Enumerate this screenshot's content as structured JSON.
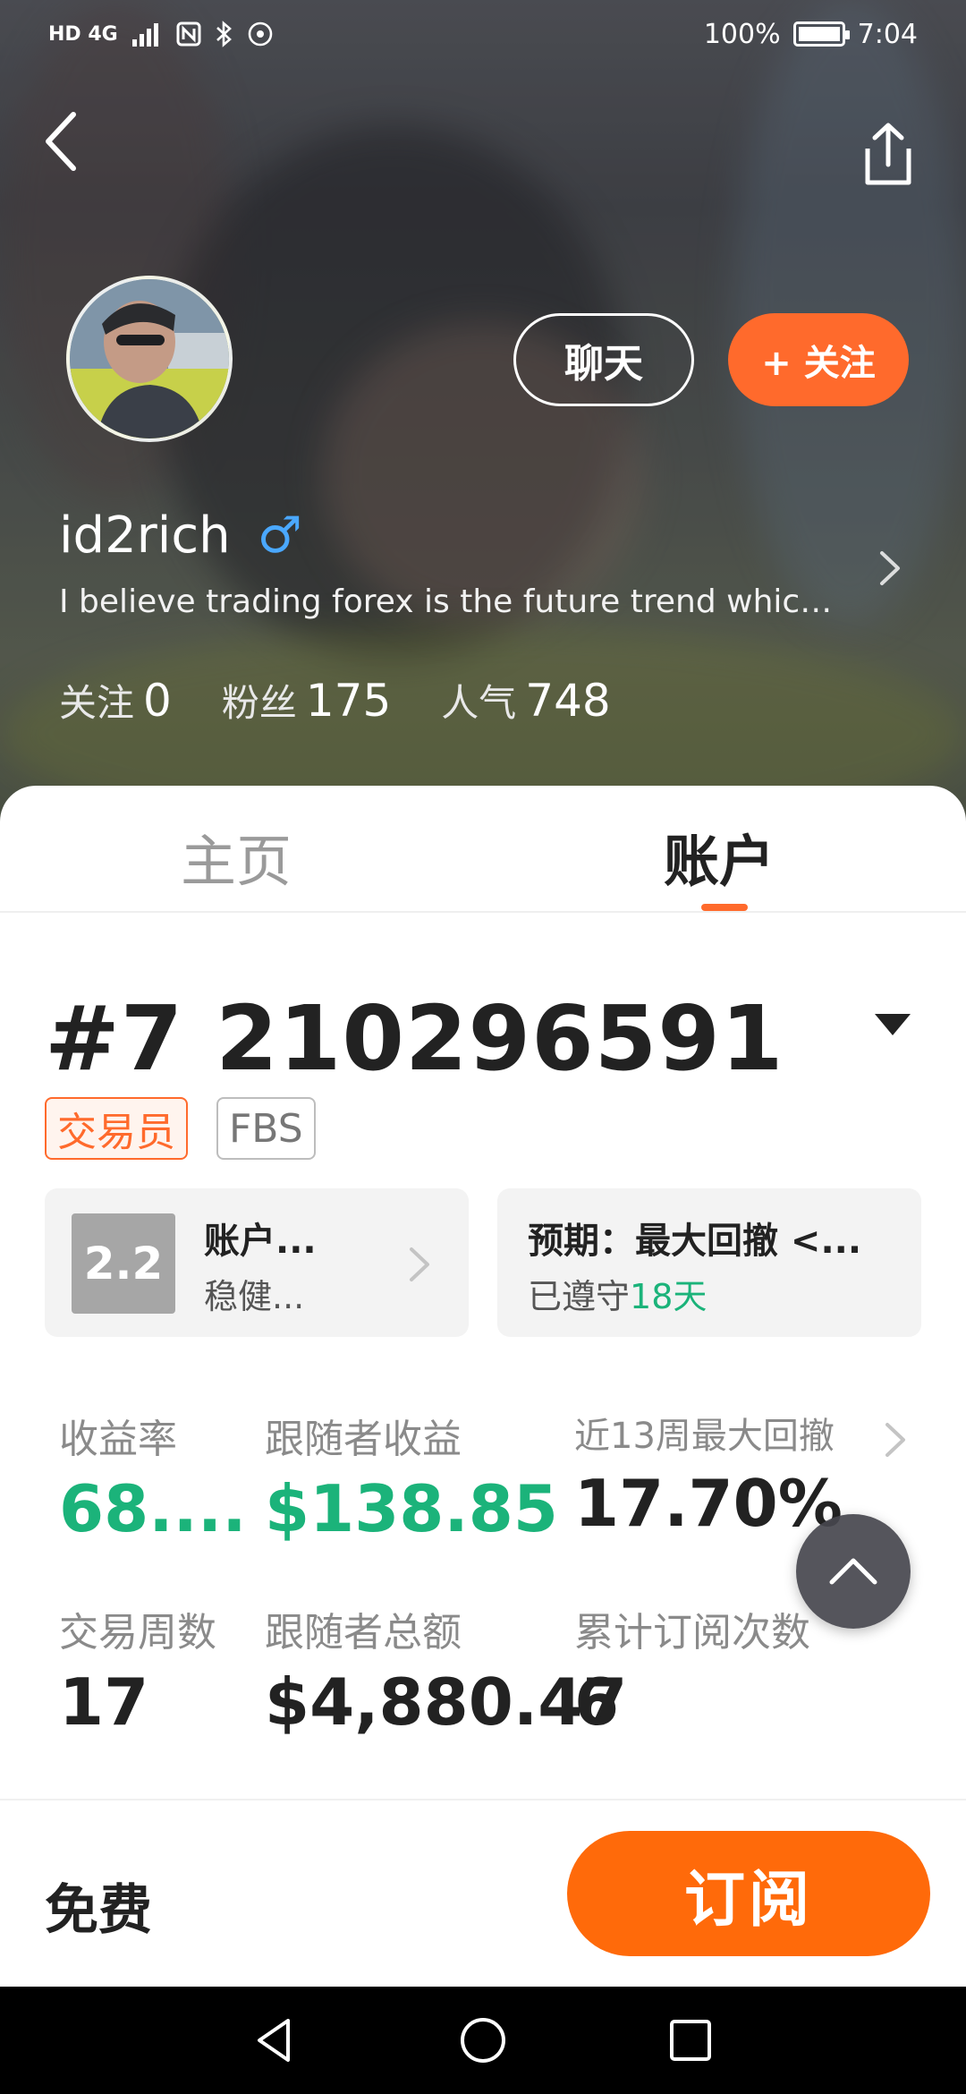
{
  "status_bar": {
    "indicators": "HD 4G",
    "battery": "100%",
    "battery_level": 1.0,
    "time": "7:04"
  },
  "profile": {
    "chat_label": "聊天",
    "follow_label": "+ 关注",
    "username": "id2rich",
    "gender_symbol": "♂",
    "bio": "I believe trading forex is the future trend which is...",
    "stats": [
      {
        "label": "关注",
        "value": "0"
      },
      {
        "label": "粉丝",
        "value": "175"
      },
      {
        "label": "人气",
        "value": "748"
      }
    ]
  },
  "tabs": [
    {
      "label": "主页",
      "active": false
    },
    {
      "label": "账户",
      "active": true
    }
  ],
  "account": {
    "title": "#7 210296591",
    "tags": [
      "交易员",
      "FBS"
    ],
    "risk_card": {
      "score": "2.2",
      "line1": "账户...",
      "line2": "稳健..."
    },
    "expectation_card": {
      "line1": "预期：最大回撤 <...",
      "line2_prefix": "已遵守",
      "line2_value": "18天"
    },
    "metrics": [
      {
        "label": "收益率",
        "value": "68....",
        "green": true
      },
      {
        "label": "跟随者收益",
        "value": "$138.85",
        "green": true
      },
      {
        "label": "近13周最大回撤",
        "value": "17.70%",
        "green": false
      },
      {
        "label": "交易周数",
        "value": "17",
        "green": false
      },
      {
        "label": "跟随者总额",
        "value": "$4,880.47",
        "green": false
      },
      {
        "label": "累计订阅次数",
        "value": "6",
        "green": false
      }
    ]
  },
  "bottom_bar": {
    "price": "免费",
    "subscribe_label": "订阅"
  },
  "colors": {
    "accent": "#ff6a2c",
    "subscribe": "#ff6a0a",
    "positive": "#1bb37a",
    "male": "#4aa8ff"
  }
}
